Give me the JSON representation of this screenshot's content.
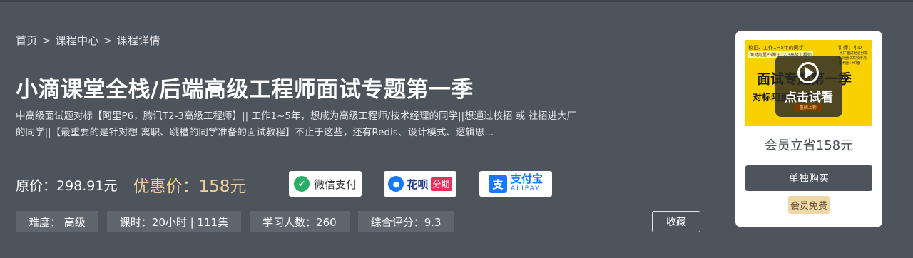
{
  "breadcrumb": {
    "home": "首页",
    "sep": ">",
    "center": "课程中心",
    "detail": "课程详情"
  },
  "course": {
    "title": "小滴课堂全栈/后端高级工程师面试专题第一季",
    "description": "中高级面试题对标【阿里P6，腾讯T2-3高级工程师】|| 工作1~5年，想成为高级工程师/技术经理的同学||想通过校招 或 社招进大厂的同学||【最重要的是针对想 离职、跳槽的同学准备的面试教程】不止于这些，还有Redis、设计模式、逻辑思..."
  },
  "price": {
    "original": "原价：298.91元",
    "sale": "优惠价：158元"
  },
  "payments": {
    "wechat": {
      "label": "微信支付",
      "icon": "wechat-icon"
    },
    "huabei": {
      "label": "花呗",
      "tag": "分期",
      "icon": "huabei-icon"
    },
    "alipay": {
      "label": "支付宝",
      "sub": "ALIPAY",
      "icon": "alipay-icon"
    }
  },
  "tags": {
    "difficulty": "难度：  高级",
    "hours": "课时：20小时 | 111集",
    "learners": "学习人数：260",
    "rating": "综合评分：9.3"
  },
  "favorite_label": "收藏",
  "card": {
    "cover": {
      "line1": "校招、工作1~5年的同学",
      "line2": "面对阿里P6腾讯T2-3高级工程师",
      "lecturer": "讲师：小D",
      "notes": "·大厂面试经验分享·针对面试高频考点·技术面+HR面",
      "headline": "面试专题第一季",
      "subline": "对标阿里P6  T2-3",
      "play_label": "点击试看",
      "play_badge": "重磅上新"
    },
    "saving": "会员立省158元",
    "buy_label": "单独购买",
    "vip_label": "会员免费"
  },
  "colors": {
    "background": "#4d545c",
    "sale_price": "#f0cf9a",
    "cover_yellow": "#f7d100",
    "vip_badge": "#efd7a8"
  }
}
